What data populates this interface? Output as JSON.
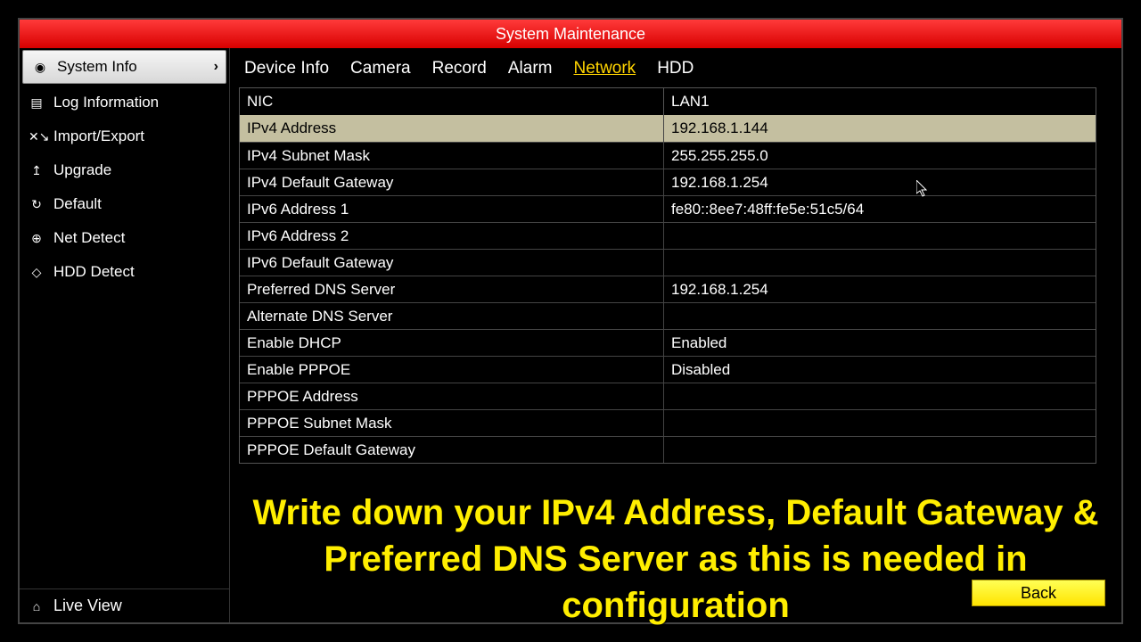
{
  "title": "System Maintenance",
  "sidebar": {
    "items": [
      {
        "label": "System Info",
        "icon": "◉",
        "active": true
      },
      {
        "label": "Log Information",
        "icon": "▤"
      },
      {
        "label": "Import/Export",
        "icon": "✕↘"
      },
      {
        "label": "Upgrade",
        "icon": "↥"
      },
      {
        "label": "Default",
        "icon": "↻"
      },
      {
        "label": "Net Detect",
        "icon": "⊕"
      },
      {
        "label": "HDD Detect",
        "icon": "◇"
      }
    ],
    "live_view": "Live View",
    "live_view_icon": "⌂"
  },
  "tabs": [
    "Device Info",
    "Camera",
    "Record",
    "Alarm",
    "Network",
    "HDD"
  ],
  "active_tab": "Network",
  "table": {
    "header": {
      "key": "NIC",
      "val": "LAN1"
    },
    "rows": [
      {
        "key": "IPv4 Address",
        "val": "192.168.1.144",
        "highlight": true
      },
      {
        "key": "IPv4 Subnet Mask",
        "val": "255.255.255.0"
      },
      {
        "key": "IPv4 Default Gateway",
        "val": "192.168.1.254"
      },
      {
        "key": "IPv6 Address 1",
        "val": "fe80::8ee7:48ff:fe5e:51c5/64"
      },
      {
        "key": "IPv6 Address 2",
        "val": ""
      },
      {
        "key": "IPv6 Default Gateway",
        "val": ""
      },
      {
        "key": "Preferred DNS Server",
        "val": "192.168.1.254"
      },
      {
        "key": "Alternate DNS Server",
        "val": ""
      },
      {
        "key": "Enable DHCP",
        "val": "Enabled"
      },
      {
        "key": "Enable PPPOE",
        "val": "Disabled"
      },
      {
        "key": "PPPOE Address",
        "val": ""
      },
      {
        "key": "PPPOE Subnet Mask",
        "val": ""
      },
      {
        "key": "PPPOE Default Gateway",
        "val": ""
      }
    ]
  },
  "overlay": "Write down your IPv4 Address, Default Gateway & Preferred DNS Server as this is needed in configuration",
  "back_label": "Back"
}
